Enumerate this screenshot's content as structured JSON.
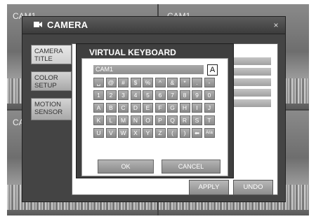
{
  "camera_views": {
    "cam1_label": "CAM1",
    "cam2_label": "CAM1",
    "cam3_label": "CA"
  },
  "camera_dialog": {
    "title": "CAMERA",
    "close_label": "×"
  },
  "side_menu": [
    {
      "label": "CAMERA TITLE"
    },
    {
      "label": "COLOR SETUP"
    },
    {
      "label": "MOTION SENSOR"
    }
  ],
  "content_buttons": {
    "apply_label": "APPLY",
    "undo_label": "UNDO"
  },
  "virtual_keyboard": {
    "title": "VIRTUAL KEYBOARD",
    "input_value": "CAM1",
    "mode_label": "A",
    "rows": [
      [
        "␣",
        "@",
        "#",
        "$",
        "%",
        "^",
        "&",
        "*",
        ".",
        "-"
      ],
      [
        "1",
        "2",
        "3",
        "4",
        "5",
        "6",
        "7",
        "8",
        "9",
        "0"
      ],
      [
        "A",
        "B",
        "C",
        "D",
        "E",
        "F",
        "G",
        "H",
        "I",
        "J"
      ],
      [
        "K",
        "L",
        "M",
        "N",
        "O",
        "P",
        "Q",
        "R",
        "S",
        "T"
      ],
      [
        "U",
        "V",
        "W",
        "X",
        "Y",
        "Z",
        "(",
        ")",
        "⬅",
        "A/a"
      ]
    ],
    "ok_label": "OK",
    "cancel_label": "CANCEL"
  }
}
